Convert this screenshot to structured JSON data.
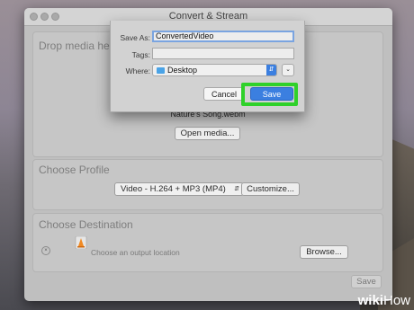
{
  "window": {
    "title": "Convert & Stream"
  },
  "drop_media": {
    "title": "Drop media her",
    "filename": "Nature's Song.webm",
    "open_button": "Open media..."
  },
  "profile": {
    "title": "Choose Profile",
    "selected": "Video - H.264 + MP3 (MP4)",
    "customize_button": "Customize..."
  },
  "destination": {
    "title": "Choose Destination",
    "placeholder": "Choose an output location",
    "browse_button": "Browse..."
  },
  "footer": {
    "save_button": "Save"
  },
  "save_dialog": {
    "save_as_label": "Save As:",
    "save_as_value": "ConvertedVideo",
    "tags_label": "Tags:",
    "tags_value": "",
    "where_label": "Where:",
    "where_value": "Desktop",
    "cancel_button": "Cancel",
    "save_button": "Save"
  },
  "watermark": {
    "wiki": "wiki",
    "how": "How"
  },
  "colors": {
    "accent": "#3b7fe0",
    "highlight": "#2fd12a",
    "window_bg": "#bfbfbf"
  },
  "icons": [
    "close-icon",
    "folder-icon",
    "chevron-updown-icon",
    "chevron-down-icon",
    "vlc-cone-icon",
    "remove-x-icon"
  ]
}
